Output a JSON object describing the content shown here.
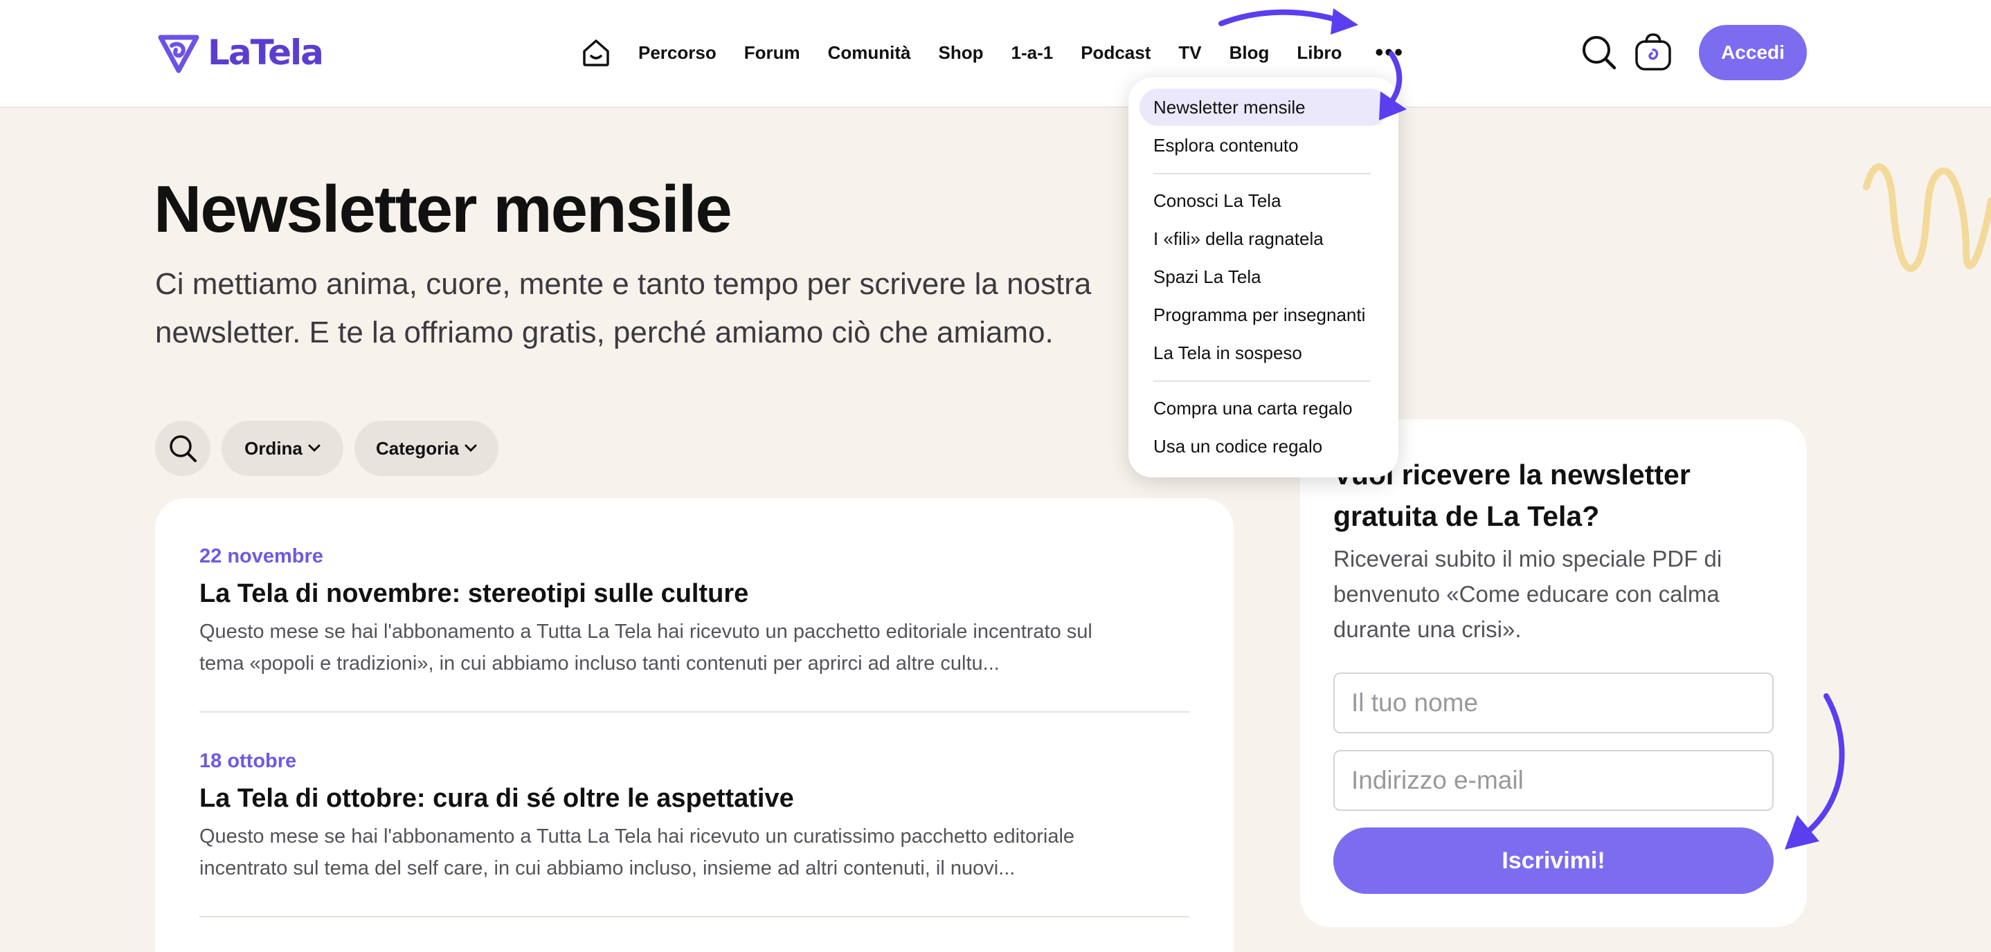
{
  "brand": {
    "name": "LaTela"
  },
  "nav": {
    "items": [
      "Percorso",
      "Forum",
      "Comunità",
      "Shop",
      "1-a-1",
      "Podcast",
      "TV",
      "Blog",
      "Libro"
    ],
    "more": "•••",
    "login_label": "Accedi"
  },
  "hero": {
    "title": "Newsletter mensile",
    "subtitle": "Ci mettiamo anima, cuore, mente e tanto tempo per scrivere la nostra newsletter. E te la offriamo gratis, perché amiamo ciò che amiamo."
  },
  "filters": {
    "sort_label": "Ordina",
    "category_label": "Categoria"
  },
  "articles": [
    {
      "date": "22 novembre",
      "title": "La Tela di novembre: stereotipi sulle culture",
      "excerpt": "Questo mese se hai l'abbonamento a Tutta La Tela hai ricevuto un pacchetto editoriale incentrato sul tema «popoli e tradizioni», in cui abbiamo incluso tanti contenuti per aprirci ad altre cultu..."
    },
    {
      "date": "18 ottobre",
      "title": "La Tela di ottobre: cura di sé oltre le aspettative",
      "excerpt": "Questo mese se hai l'abbonamento a Tutta La Tela hai ricevuto un curatissimo pacchetto editoriale incentrato sul tema del self care, in cui abbiamo incluso, insieme ad altri contenuti, il nuovi..."
    }
  ],
  "newsletter_card": {
    "title": "Vuoi ricevere la newsletter gratuita de La Tela?",
    "description": "Riceverai subito il mio speciale PDF di benvenuto «Come educare con calma durante una crisi».",
    "name_placeholder": "Il tuo nome",
    "email_placeholder": "Indirizzo e-mail",
    "submit_label": "Iscrivimi!"
  },
  "dropdown": {
    "group1": [
      "Newsletter mensile",
      "Esplora contenuto"
    ],
    "group2": [
      "Conosci La Tela",
      "I «fili» della ragnatela",
      "Spazi La Tela",
      "Programma per insegnanti",
      "La Tela in sospeso"
    ],
    "group3": [
      "Compra una carta regalo",
      "Usa un codice regalo"
    ]
  },
  "colors": {
    "accent": "#7b6cf0",
    "brand": "#5b3ed0",
    "background": "#f7f3ec",
    "arrow": "#5a3ef0",
    "squiggle": "#f3d99a"
  },
  "icons": [
    "home-icon",
    "search-icon",
    "bag-icon",
    "more-icon",
    "chevron-down-icon"
  ]
}
